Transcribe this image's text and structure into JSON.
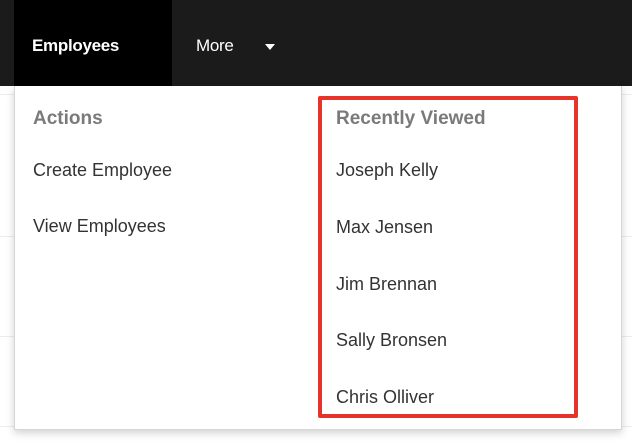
{
  "navbar": {
    "active_tab_label": "Employees",
    "more_label": "More"
  },
  "dropdown": {
    "actions": {
      "heading": "Actions",
      "items": [
        "Create Employee",
        "View Employees"
      ]
    },
    "recently_viewed": {
      "heading": "Recently Viewed",
      "items": [
        "Joseph Kelly",
        "Max Jensen",
        "Jim Brennan",
        "Sally Bronsen",
        "Chris Olliver"
      ]
    }
  },
  "colors": {
    "navbar_bg": "#1b1b1b",
    "active_tab_bg": "#000000",
    "heading_text": "#7a7a7a",
    "item_text": "#333333",
    "highlight_border": "#e8332a"
  },
  "icons": {
    "more_caret": "caret-down-icon"
  }
}
